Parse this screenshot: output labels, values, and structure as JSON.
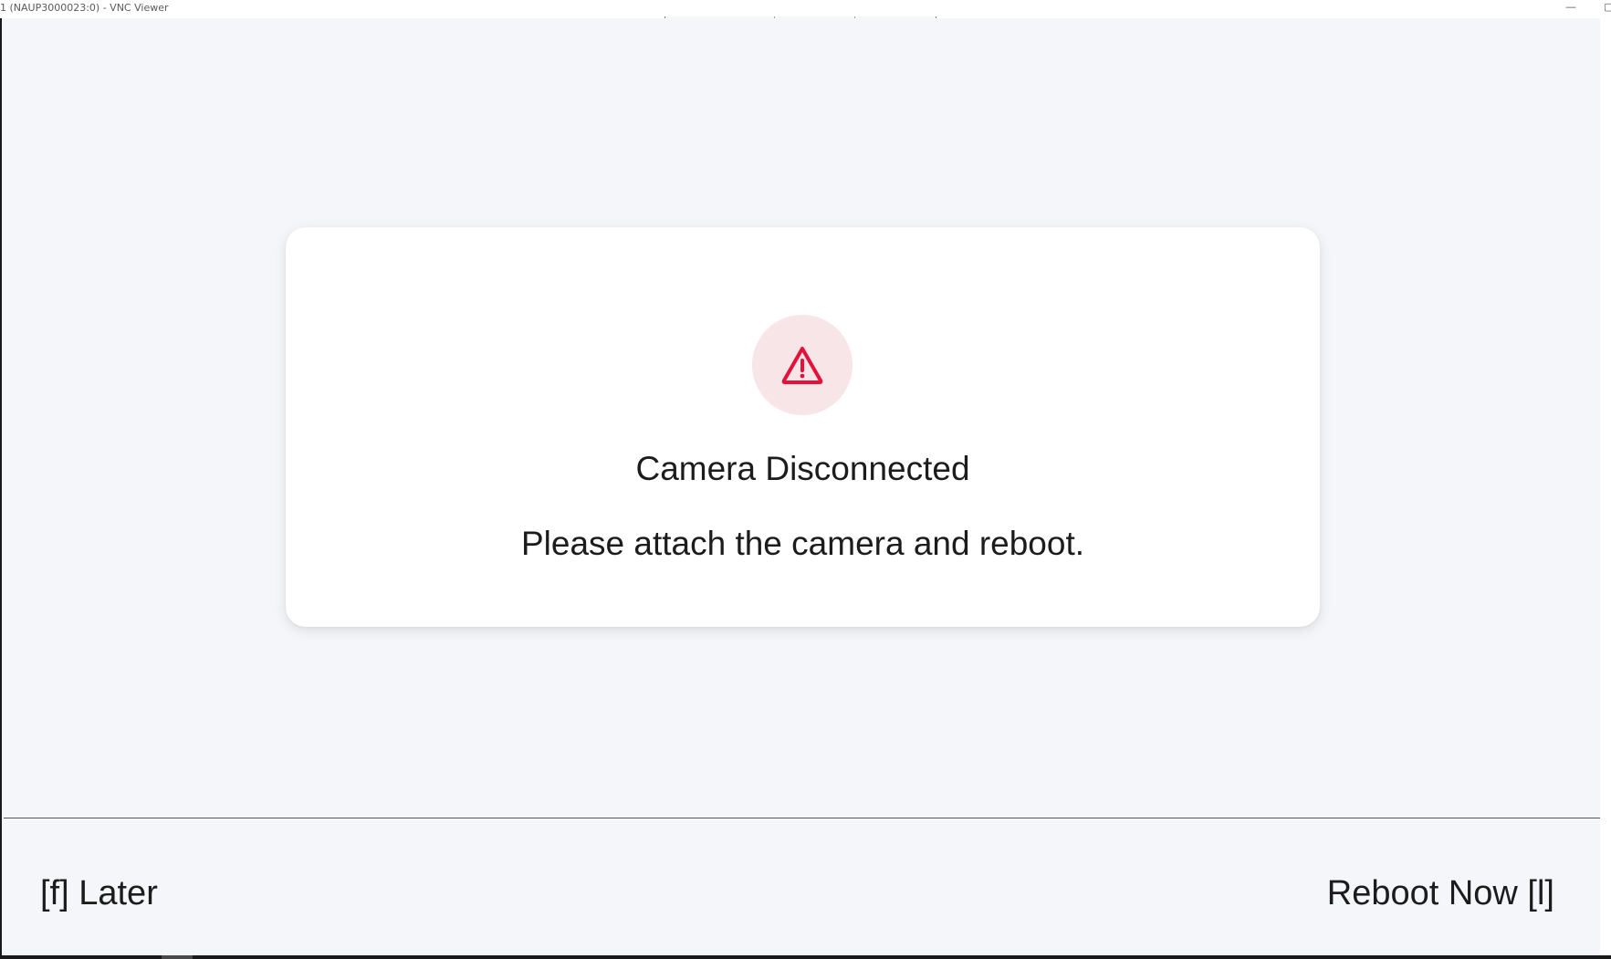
{
  "window": {
    "title": "1 (NAUP3000023:0) - VNC Viewer",
    "minimize_glyph": "—"
  },
  "dialog": {
    "icon": "warning-triangle-icon",
    "icon_color": "#e3123b",
    "icon_bg_color": "#f8e5e8",
    "title": "Camera Disconnected",
    "message": "Please attach the camera and reboot."
  },
  "footer": {
    "left_action": "[f] Later",
    "right_action": "Reboot Now [l]"
  },
  "colors": {
    "background": "#f5f6fa",
    "card": "#ffffff",
    "text": "#1c1c1c"
  }
}
